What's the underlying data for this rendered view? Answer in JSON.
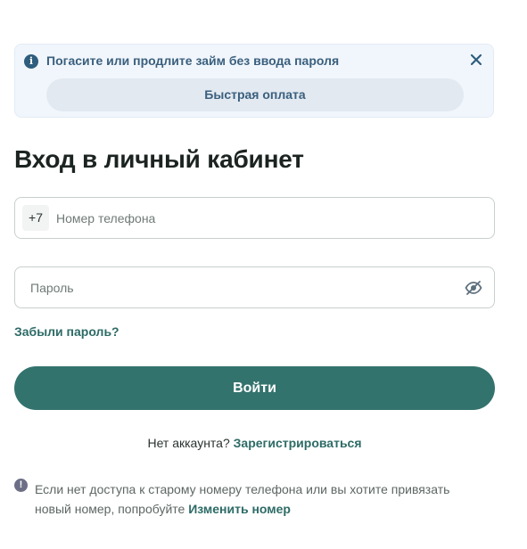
{
  "banner": {
    "info_icon": "info-icon",
    "text": "Погасите или продлите займ без ввода пароля",
    "close_icon": "close-icon",
    "quick_pay_label": "Быстрая оплата"
  },
  "page": {
    "title": "Вход в личный кабинет"
  },
  "phone": {
    "prefix": "+7",
    "placeholder": "Номер телефона",
    "value": ""
  },
  "password": {
    "placeholder": "Пароль",
    "value": "",
    "toggle_icon": "eye-off-icon"
  },
  "forgot_password_label": "Забыли пароль?",
  "login_button_label": "Войти",
  "register": {
    "prompt": "Нет аккаунта?",
    "link_label": "Зарегистрироваться"
  },
  "note": {
    "icon": "exclamation-icon",
    "text": "Если нет доступа к старому номеру телефона или вы хотите привязать новый номер, попробуйте",
    "link_label": "Изменить номер"
  },
  "colors": {
    "accent": "#33736d",
    "link": "#2d6b66",
    "banner_bg": "#f1f6fc",
    "banner_text": "#3a5f7d"
  }
}
